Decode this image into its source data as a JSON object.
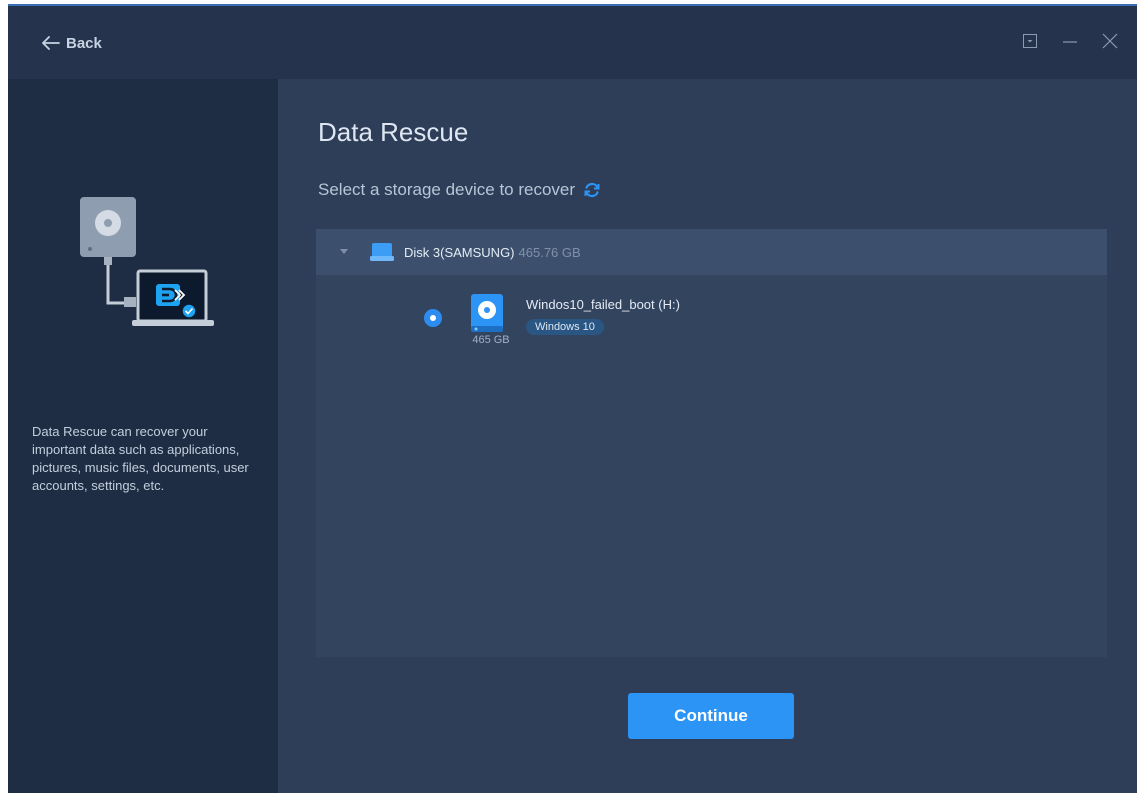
{
  "header": {
    "back_label": "Back",
    "controls": [
      {
        "name": "menu-icon"
      },
      {
        "name": "minimize-icon"
      },
      {
        "name": "close-icon"
      }
    ]
  },
  "sidebar": {
    "description": "Data Rescue can recover your important data such as applications, pictures, music files, documents, user accounts, settings, etc."
  },
  "main": {
    "title": "Data Rescue",
    "subtitle": "Select a storage device to recover",
    "disk": {
      "label": "Disk 3(SAMSUNG)",
      "size": "465.76 GB",
      "expanded": true
    },
    "partitions": [
      {
        "name": "Windos10_failed_boot (H:)",
        "size": "465 GB",
        "os": "Windows 10",
        "selected": true
      }
    ],
    "continue_label": "Continue"
  },
  "colors": {
    "accent": "#2b94f5",
    "sidebar_bg": "#1f2d44",
    "main_bg": "#2e3e58",
    "panel_bg": "#33445f"
  }
}
